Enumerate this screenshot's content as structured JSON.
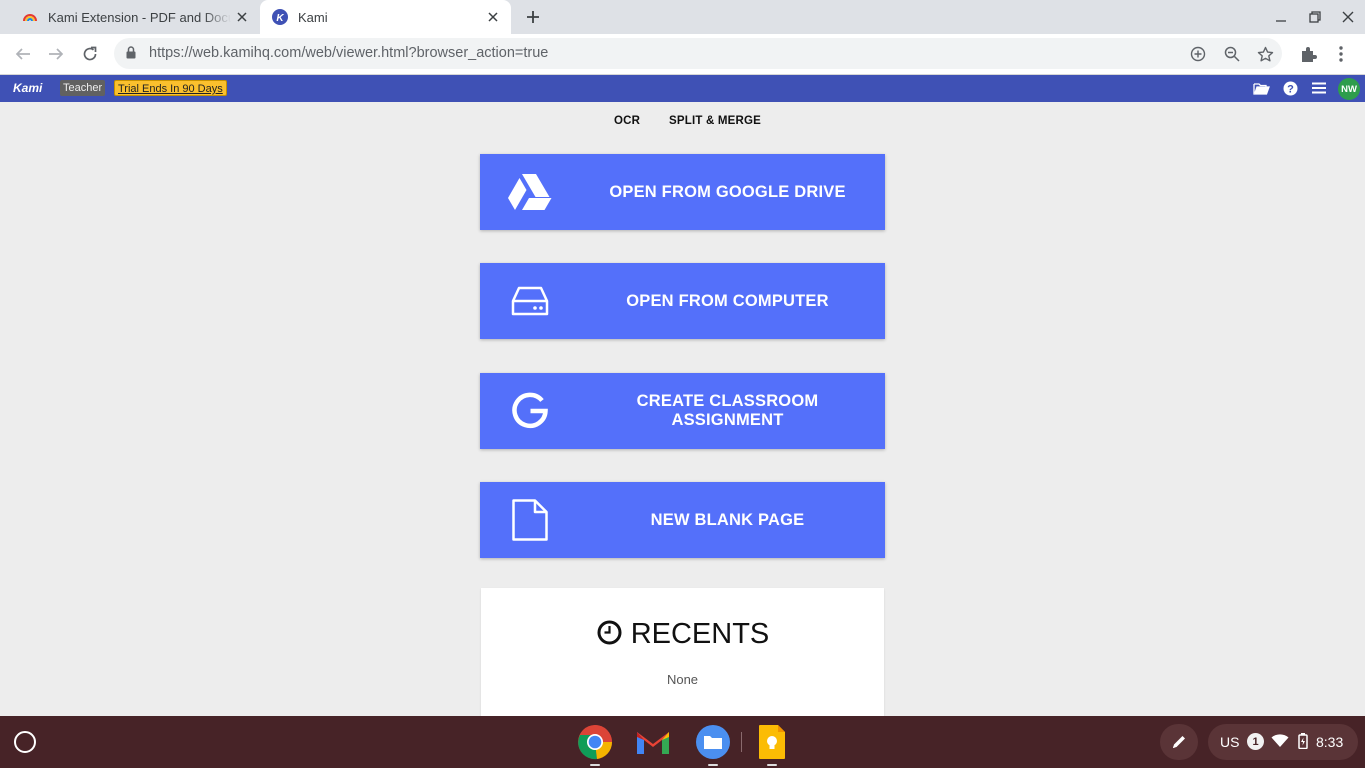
{
  "browser": {
    "tabs": [
      {
        "title": "Kami Extension - PDF and Document Annotation",
        "active": false,
        "favicon": "kami-rainbow-icon"
      },
      {
        "title": "Kami",
        "active": true,
        "favicon": "kami-k-icon"
      }
    ],
    "url_domain": "https://web.kamihq.com",
    "url_path": "/web/viewer.html?browser_action=true"
  },
  "kami_header": {
    "logo": "Kami",
    "role_badge": "Teacher",
    "trial_badge": "Trial Ends In 90 Days",
    "avatar_initials": "NW",
    "colors": {
      "bar": "#3f51b5",
      "trial": "#fbc02d",
      "avatar": "#2e9d4c"
    }
  },
  "top_nav": {
    "ocr": "OCR",
    "split_merge": "SPLIT & MERGE"
  },
  "actions": [
    {
      "label": "OPEN FROM GOOGLE DRIVE",
      "icon": "google-drive-icon"
    },
    {
      "label": "OPEN FROM COMPUTER",
      "icon": "hard-drive-icon"
    },
    {
      "label": "CREATE CLASSROOM ASSIGNMENT",
      "icon": "google-g-icon"
    },
    {
      "label": "NEW BLANK PAGE",
      "icon": "blank-page-icon"
    }
  ],
  "action_color": "#5470fa",
  "recents": {
    "title": "RECENTS",
    "empty_text": "None"
  },
  "shelf": {
    "apps": [
      "chrome-icon",
      "gmail-icon",
      "files-icon",
      "keep-icon"
    ],
    "ime": "US",
    "notification_count": "1",
    "time": "8:33"
  }
}
